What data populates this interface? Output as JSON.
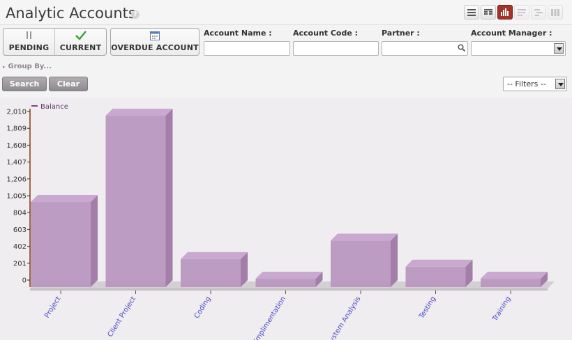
{
  "page": {
    "title": "Analytic Accounts",
    "help_icon": "?"
  },
  "view_switcher": [
    {
      "name": "list-view-icon",
      "active": false,
      "disabled": false
    },
    {
      "name": "form-view-icon",
      "active": false,
      "disabled": false
    },
    {
      "name": "graph-view-icon",
      "active": true,
      "disabled": false
    },
    {
      "name": "calendar-view-icon",
      "active": false,
      "disabled": true
    },
    {
      "name": "gantt-view-icon",
      "active": false,
      "disabled": true
    },
    {
      "name": "kanban-view-icon",
      "active": false,
      "disabled": true
    }
  ],
  "filters": {
    "pending": "PENDING",
    "current": "CURRENT",
    "overdue": "OVERDUE ACCOUNT"
  },
  "fields": {
    "account_name": {
      "label": "Account Name :",
      "value": ""
    },
    "account_code": {
      "label": "Account Code :",
      "value": ""
    },
    "partner": {
      "label": "Partner :",
      "value": ""
    },
    "account_manager": {
      "label": "Account Manager :",
      "value": ""
    }
  },
  "group_by": "Group By...",
  "buttons": {
    "search": "Search",
    "clear": "Clear"
  },
  "filters_select": {
    "selected": "-- Filters --"
  },
  "colors": {
    "accent": "#a43227",
    "bar_front": "#b895bf",
    "bar_side": "#a27ea9",
    "bar_top": "#c9a9cf",
    "axis": "#8a3b10"
  },
  "chart_data": {
    "type": "bar",
    "title": "",
    "xlabel": "",
    "ylabel": "",
    "categories": [
      "Project",
      "Client Project",
      "Coding",
      "Implimentation",
      "System Analysis",
      "Testing",
      "Training"
    ],
    "series": [
      {
        "name": "Balance",
        "values": [
          930,
          1960,
          250,
          10,
          470,
          160,
          0
        ]
      }
    ],
    "y_ticks": [
      "0",
      "201",
      "402",
      "603",
      "804",
      "1,005",
      "1,206",
      "1,407",
      "1,608",
      "1,809",
      "2,010"
    ],
    "ylim": [
      0,
      2010
    ],
    "legend_position": "top-left",
    "style": "3d"
  }
}
